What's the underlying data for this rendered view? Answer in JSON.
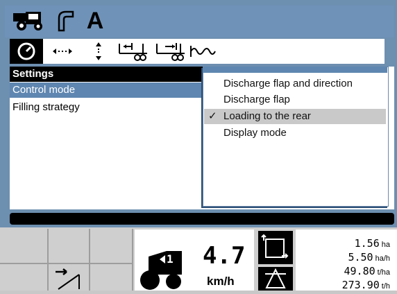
{
  "top_bar": {
    "icons": [
      "harvester-icon",
      "spout-icon",
      "auto-mode-icon"
    ],
    "auto_label": "A"
  },
  "tabs": [
    {
      "icon": "speedometer-icon"
    },
    {
      "icon": "horizontal-arrows-icon"
    },
    {
      "icon": "vertical-arrows-icon"
    },
    {
      "icon": "trailer-front-icon"
    },
    {
      "icon": "trailer-rear-icon"
    },
    {
      "icon": "wave-icon"
    }
  ],
  "settings": {
    "title": "Settings",
    "items": [
      {
        "label": "Control mode",
        "selected": true
      },
      {
        "label": "Filling strategy",
        "selected": false
      }
    ]
  },
  "dropdown": {
    "options": [
      {
        "label": "Discharge flap and direction",
        "checked": false
      },
      {
        "label": "Discharge flap",
        "checked": false
      },
      {
        "label": "Loading to the rear",
        "checked": true
      },
      {
        "label": "Display mode",
        "checked": false
      }
    ],
    "check_mark": "✓"
  },
  "bottom": {
    "left_icon": "flap-toggle-icon",
    "gear_label": "1",
    "speed_value": "4.7",
    "speed_unit": "km/h",
    "stats": [
      {
        "value": "1.56",
        "unit": "ha"
      },
      {
        "value": "5.50",
        "unit": "ha/h"
      },
      {
        "value": "49.80",
        "unit": "t/ha"
      },
      {
        "value": "273.90",
        "unit": "t/h"
      }
    ]
  },
  "colors": {
    "frame_blue": "#6d8fb0",
    "selected_row": "#5e86b0",
    "selected_option": "#c9c9c9"
  }
}
